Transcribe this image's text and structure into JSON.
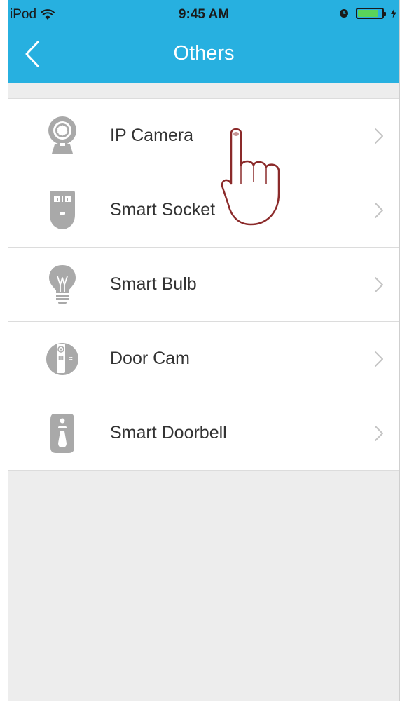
{
  "status_bar": {
    "carrier": "iPod",
    "time": "9:45 AM",
    "icons": [
      "wifi-icon",
      "alarm-icon",
      "battery-icon",
      "charging-icon"
    ]
  },
  "nav": {
    "title": "Others",
    "back_icon": "chevron-left-icon"
  },
  "items": [
    {
      "label": "IP Camera",
      "icon": "ip-camera-icon"
    },
    {
      "label": "Smart Socket",
      "icon": "smart-socket-icon"
    },
    {
      "label": "Smart Bulb",
      "icon": "smart-bulb-icon"
    },
    {
      "label": "Door Cam",
      "icon": "door-cam-icon"
    },
    {
      "label": "Smart Doorbell",
      "icon": "smart-doorbell-icon"
    }
  ],
  "colors": {
    "header": "#27b0e0",
    "background": "#ededed",
    "icon_gray": "#a9a9a9",
    "battery_green": "#5ad45a",
    "hand_outline": "#8b2a2a"
  },
  "battery_level": 0.85
}
